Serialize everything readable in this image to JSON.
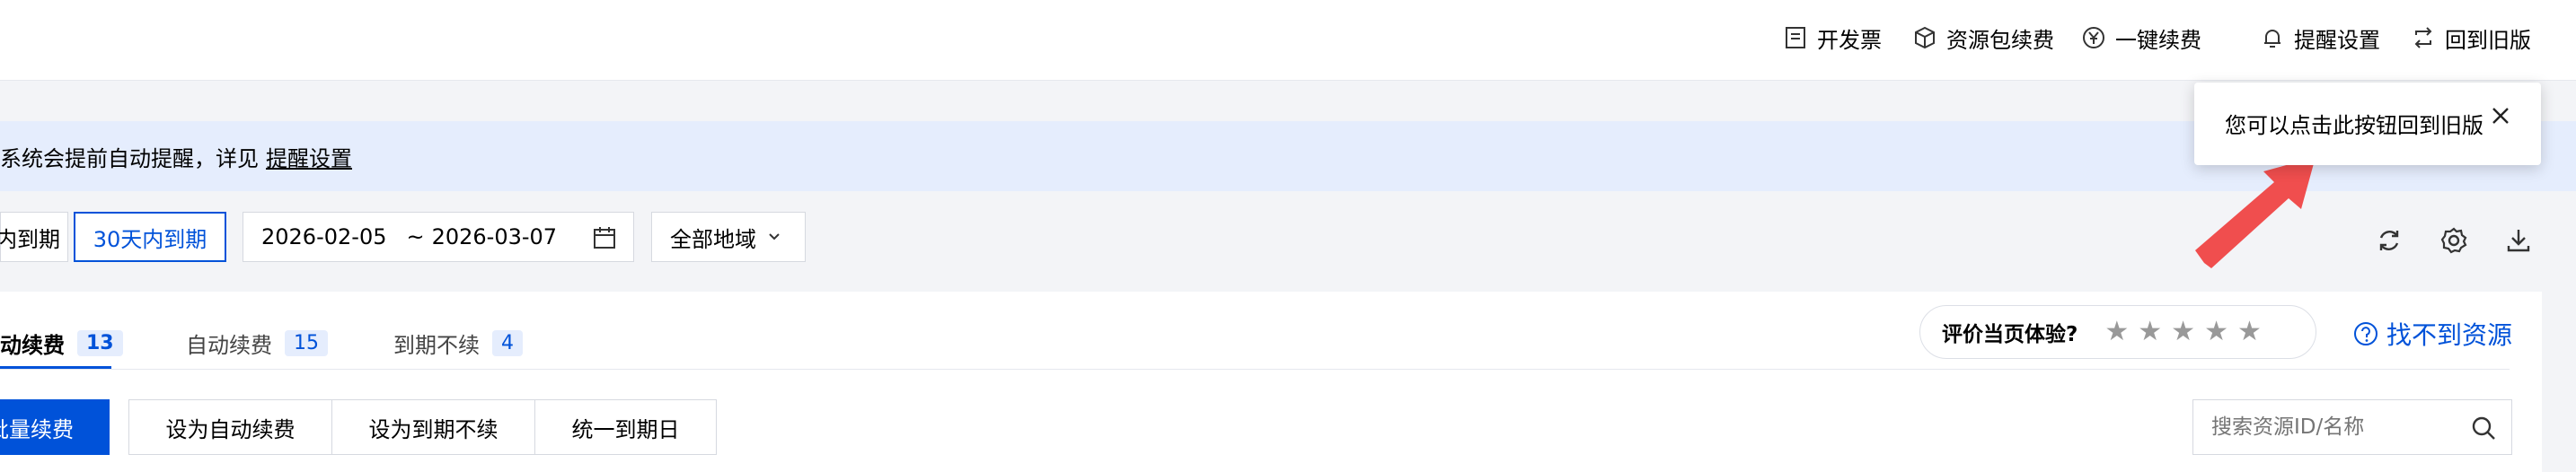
{
  "header": {
    "links": [
      {
        "label": "开发票",
        "icon": "invoice-icon"
      },
      {
        "label": "资源包续费",
        "icon": "package-icon"
      },
      {
        "label": "一键续费",
        "icon": "yen-icon"
      },
      {
        "label": "提醒设置",
        "icon": "bell-icon"
      },
      {
        "label": "回到旧版",
        "icon": "switch-icon"
      }
    ]
  },
  "banner": {
    "text": "系统会提前自动提醒，详见",
    "link_label": "提醒设置"
  },
  "filters": {
    "chips": [
      "内到期",
      "30天内到期"
    ],
    "date_start": "2026-02-05",
    "date_separator": "~",
    "date_end": "2026-03-07",
    "region_select": "全部地域"
  },
  "tabs": [
    {
      "label": "动续费",
      "count": "13"
    },
    {
      "label": "自动续费",
      "count": "15"
    },
    {
      "label": "到期不续",
      "count": "4"
    }
  ],
  "rating": {
    "label": "评价当页体验?",
    "stars": 5,
    "star_glyph": "★"
  },
  "help_link": "找不到资源",
  "actions": {
    "primary": "批量续费",
    "group": [
      "设为自动续费",
      "设为到期不续",
      "统一到期日"
    ]
  },
  "search": {
    "placeholder": "搜索资源ID/名称"
  },
  "popover": {
    "message": "您可以点击此按钮回到旧版"
  },
  "colors": {
    "brand": "#0052d9",
    "banner_bg": "#e5edfd",
    "arrow": "#f04e4e"
  }
}
